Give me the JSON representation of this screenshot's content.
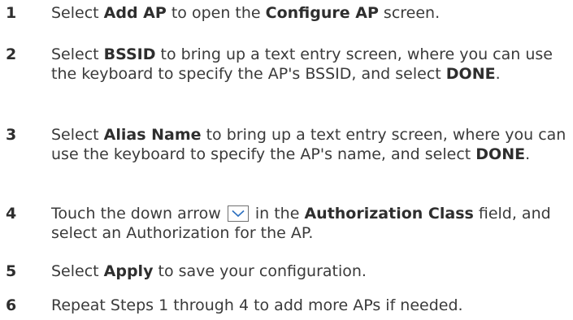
{
  "steps": [
    {
      "number": "1",
      "t0": "Select ",
      "b0": "Add AP",
      "t1": " to open the ",
      "b1": "Configure AP",
      "t2": " screen."
    },
    {
      "number": "2",
      "t0": "Select ",
      "b0": "BSSID",
      "t1": " to bring up a text entry screen, where you can use the keyboard to specify the AP's BSSID, and select ",
      "b1": "DONE",
      "t2": "."
    },
    {
      "number": "3",
      "t0": "Select ",
      "b0": "Alias Name",
      "t1": " to bring up a text entry screen, where you can use the keyboard to specify the AP's name, and select ",
      "b1": "DONE",
      "t2": "."
    },
    {
      "number": "4",
      "t0": "Touch the down arrow",
      "icon": "chevron-down-icon",
      "t1": "in the ",
      "b1": "Authorization Class",
      "t2": " field, and select an Authorization for the AP."
    },
    {
      "number": "5",
      "t0": "Select ",
      "b0": "Apply",
      "t1": " to save your configuration."
    },
    {
      "number": "6",
      "t0": "Repeat Steps 1 through 4 to add more APs if needed."
    }
  ]
}
